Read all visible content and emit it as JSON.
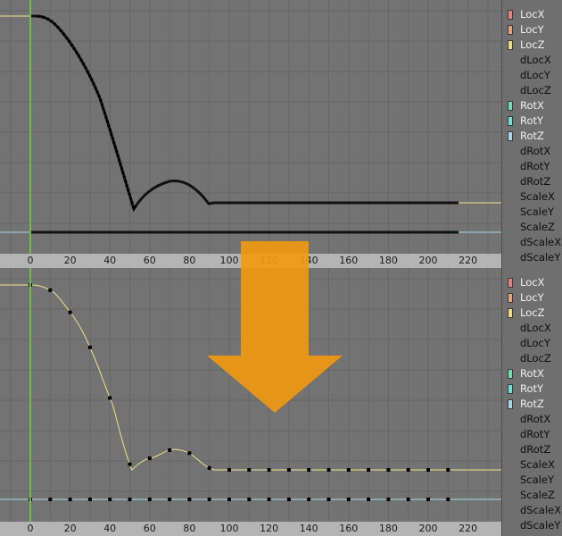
{
  "colors": {
    "background": "#737373",
    "grid": "#666666",
    "ruler": "#b4b4b4",
    "frame_cursor": "#6ebe45",
    "curve_selected": "#111111",
    "curve_loc_z": "#f0e08c",
    "curve_rot_z": "#a8d8e8",
    "arrow": "#f29a10"
  },
  "ruler": {
    "ticks": [
      "0",
      "20",
      "40",
      "60",
      "80",
      "100",
      "120",
      "140",
      "160",
      "180",
      "200",
      "220"
    ]
  },
  "current_frame": 0,
  "panels": [
    {
      "id": "top",
      "state": "selected-curves",
      "channels": [
        {
          "label": "LocX",
          "color": "#e88080"
        },
        {
          "label": "LocY",
          "color": "#e8a080"
        },
        {
          "label": "LocZ",
          "color": "#f0dc80"
        },
        {
          "label": "dLocX",
          "color": null
        },
        {
          "label": "dLocY",
          "color": null
        },
        {
          "label": "dLocZ",
          "color": null
        },
        {
          "label": "RotX",
          "color": "#70e0a8"
        },
        {
          "label": "RotY",
          "color": "#70e0d4"
        },
        {
          "label": "RotZ",
          "color": "#a8d8e8"
        },
        {
          "label": "dRotX",
          "color": null
        },
        {
          "label": "dRotY",
          "color": null
        },
        {
          "label": "dRotZ",
          "color": null
        },
        {
          "label": "ScaleX",
          "color": null
        },
        {
          "label": "ScaleY",
          "color": null
        },
        {
          "label": "ScaleZ",
          "color": null
        },
        {
          "label": "dScaleX",
          "color": null
        },
        {
          "label": "dScaleY",
          "color": null
        }
      ]
    },
    {
      "id": "bottom",
      "state": "baked-keyframes",
      "channels": [
        {
          "label": "LocX",
          "color": "#e88080"
        },
        {
          "label": "LocY",
          "color": "#e8a080"
        },
        {
          "label": "LocZ",
          "color": "#f0dc80"
        },
        {
          "label": "dLocX",
          "color": null
        },
        {
          "label": "dLocY",
          "color": null
        },
        {
          "label": "dLocZ",
          "color": null
        },
        {
          "label": "RotX",
          "color": "#70e0a8"
        },
        {
          "label": "RotY",
          "color": "#70e0d4"
        },
        {
          "label": "RotZ",
          "color": "#a8d8e8"
        },
        {
          "label": "dRotX",
          "color": null
        },
        {
          "label": "dRotY",
          "color": null
        },
        {
          "label": "dRotZ",
          "color": null
        },
        {
          "label": "ScaleX",
          "color": null
        },
        {
          "label": "ScaleY",
          "color": null
        },
        {
          "label": "ScaleZ",
          "color": null
        },
        {
          "label": "dScaleX",
          "color": null
        },
        {
          "label": "dScaleY",
          "color": null
        }
      ]
    }
  ]
}
